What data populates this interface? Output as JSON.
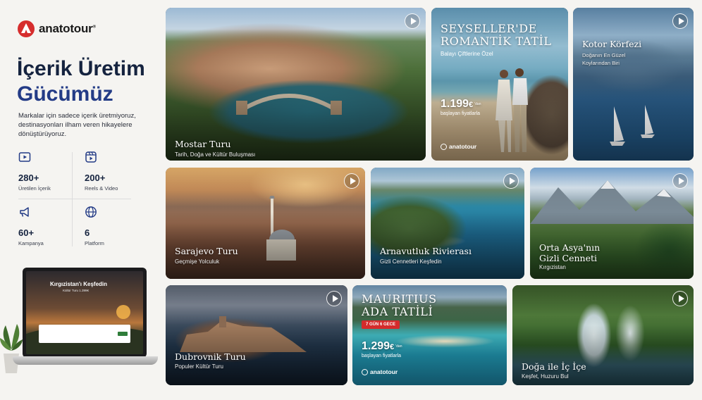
{
  "brand": {
    "name": "anatotour",
    "reg": "®"
  },
  "headline": {
    "line1": "İçerik Üretim",
    "line2": "Gücümüz"
  },
  "description": "Markalar için sadece içerik üretmiyoruz, destinasyonları ilham veren hikayelere dönüştürüyoruz.",
  "stats": [
    {
      "value": "280+",
      "label": "Üretilen İçerik",
      "icon": "play-icon"
    },
    {
      "value": "200+",
      "label": "Reels & Video",
      "icon": "reels-icon"
    },
    {
      "value": "60+",
      "label": "Kampanya",
      "icon": "megaphone-icon"
    },
    {
      "value": "6",
      "label": "Platform",
      "icon": "globe-icon"
    }
  ],
  "laptop": {
    "title": "Kırgızistan'ı Keşfedin",
    "subtitle": "Kültür Turu  1.399€"
  },
  "cards": {
    "mostar": {
      "title": "Mostar Turu",
      "subtitle": "Tarih, Doğa ve Kültür Buluşması"
    },
    "seychelles": {
      "title_l1": "SEYSELLER'DE",
      "title_l2": "ROMANTİK TATİL",
      "subtitle": "Balayı Çiftlerine Özel",
      "price": "1.199",
      "currency": "€",
      "from": "'dan",
      "price_note": "başlayan fiyatlarla",
      "brand": "anatotour"
    },
    "kotor": {
      "title": "Kotor Körfezi",
      "subtitle_l1": "Doğanın En Güzel",
      "subtitle_l2": "Koylarından Biri"
    },
    "sarajevo": {
      "title": "Sarajevo Turu",
      "subtitle": "Geçmişe Yolculuk"
    },
    "albania": {
      "title": "Arnavutluk Rivierası",
      "subtitle": "Gizli Cennetleri Keşfedin"
    },
    "asia": {
      "title_l1": "Orta Asya'nın",
      "title_l2": "Gizli Cenneti",
      "subtitle": "Kırgızistan"
    },
    "dubrovnik": {
      "title": "Dubrovnik Turu",
      "subtitle": "Populer Kültür Turu"
    },
    "mauritius": {
      "title_l1": "MAURITIUS",
      "title_l2": "ADA TATİLİ",
      "badge": "7 GÜN 6 GECE",
      "price": "1.299",
      "currency": "€",
      "from": "'dan",
      "price_note": "başlayan fiyatlarla",
      "brand": "anatotour"
    },
    "nature": {
      "title": "Doğa ile İç İçe",
      "subtitle": "Keşfet, Huzuru Bul"
    }
  },
  "colors": {
    "navy": "#15233f",
    "accent_blue": "#233b86",
    "brand_red": "#d62d2d",
    "badge_red": "#d42b2b"
  }
}
